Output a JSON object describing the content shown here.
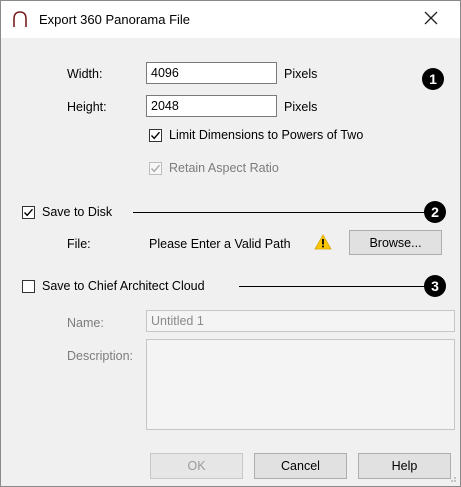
{
  "title": "Export 360 Panorama File",
  "close_glyph": "✕",
  "size": {
    "width_label": "Width:",
    "width_value": "4096",
    "height_label": "Height:",
    "height_value": "2048",
    "units": "Pixels",
    "limit_powers_label": "Limit Dimensions to Powers of Two",
    "limit_powers_checked": true,
    "retain_aspect_label": "Retain Aspect Ratio",
    "retain_aspect_checked": true,
    "retain_aspect_enabled": false
  },
  "save_to_disk": {
    "label": "Save to Disk",
    "checked": true,
    "file_label": "File:",
    "file_status": "Please Enter a Valid Path",
    "browse_label": "Browse..."
  },
  "cloud": {
    "label": "Save to Chief Architect Cloud",
    "checked": false,
    "name_label": "Name:",
    "name_value": "Untitled 1",
    "description_label": "Description:",
    "description_value": ""
  },
  "callouts": [
    "1",
    "2",
    "3"
  ],
  "buttons": {
    "ok": "OK",
    "cancel": "Cancel",
    "help": "Help"
  },
  "icons": [
    "chief-architect-logo-icon",
    "close-icon",
    "check-icon",
    "warning-icon"
  ],
  "colors": {
    "warning": "#f7c600",
    "callout": "#000000"
  }
}
